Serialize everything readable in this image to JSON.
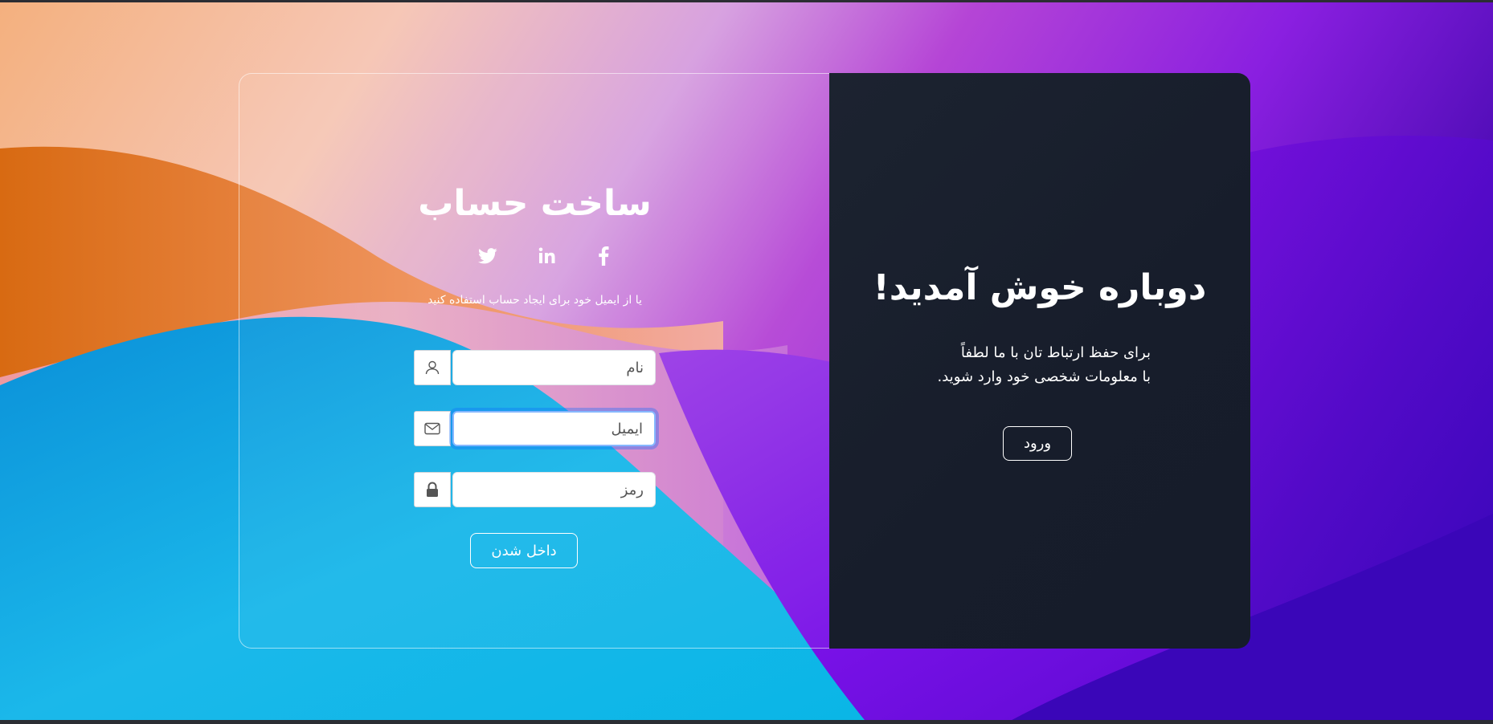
{
  "signup": {
    "title": "ساخت حساب",
    "subtitle": "یا از ایمیل خود برای ایجاد حساب استفاده کنید",
    "socials": [
      "twitter-icon",
      "linkedin-icon",
      "facebook-icon"
    ],
    "name_placeholder": "نام",
    "email_placeholder": "ایمیل",
    "password_placeholder": "رمز",
    "submit_label": "داخل شدن"
  },
  "welcome": {
    "title": "دوباره خوش آمدید!",
    "line1": "برای حفظ ارتباط تان با ما لطفاً",
    "line2": "با معلومات شخصی خود وارد شوید.",
    "login_label": "ورود"
  },
  "colors": {
    "dark_panel": "#171d2b",
    "focus_ring": "#86b7fe",
    "text_light": "#ffffff"
  }
}
